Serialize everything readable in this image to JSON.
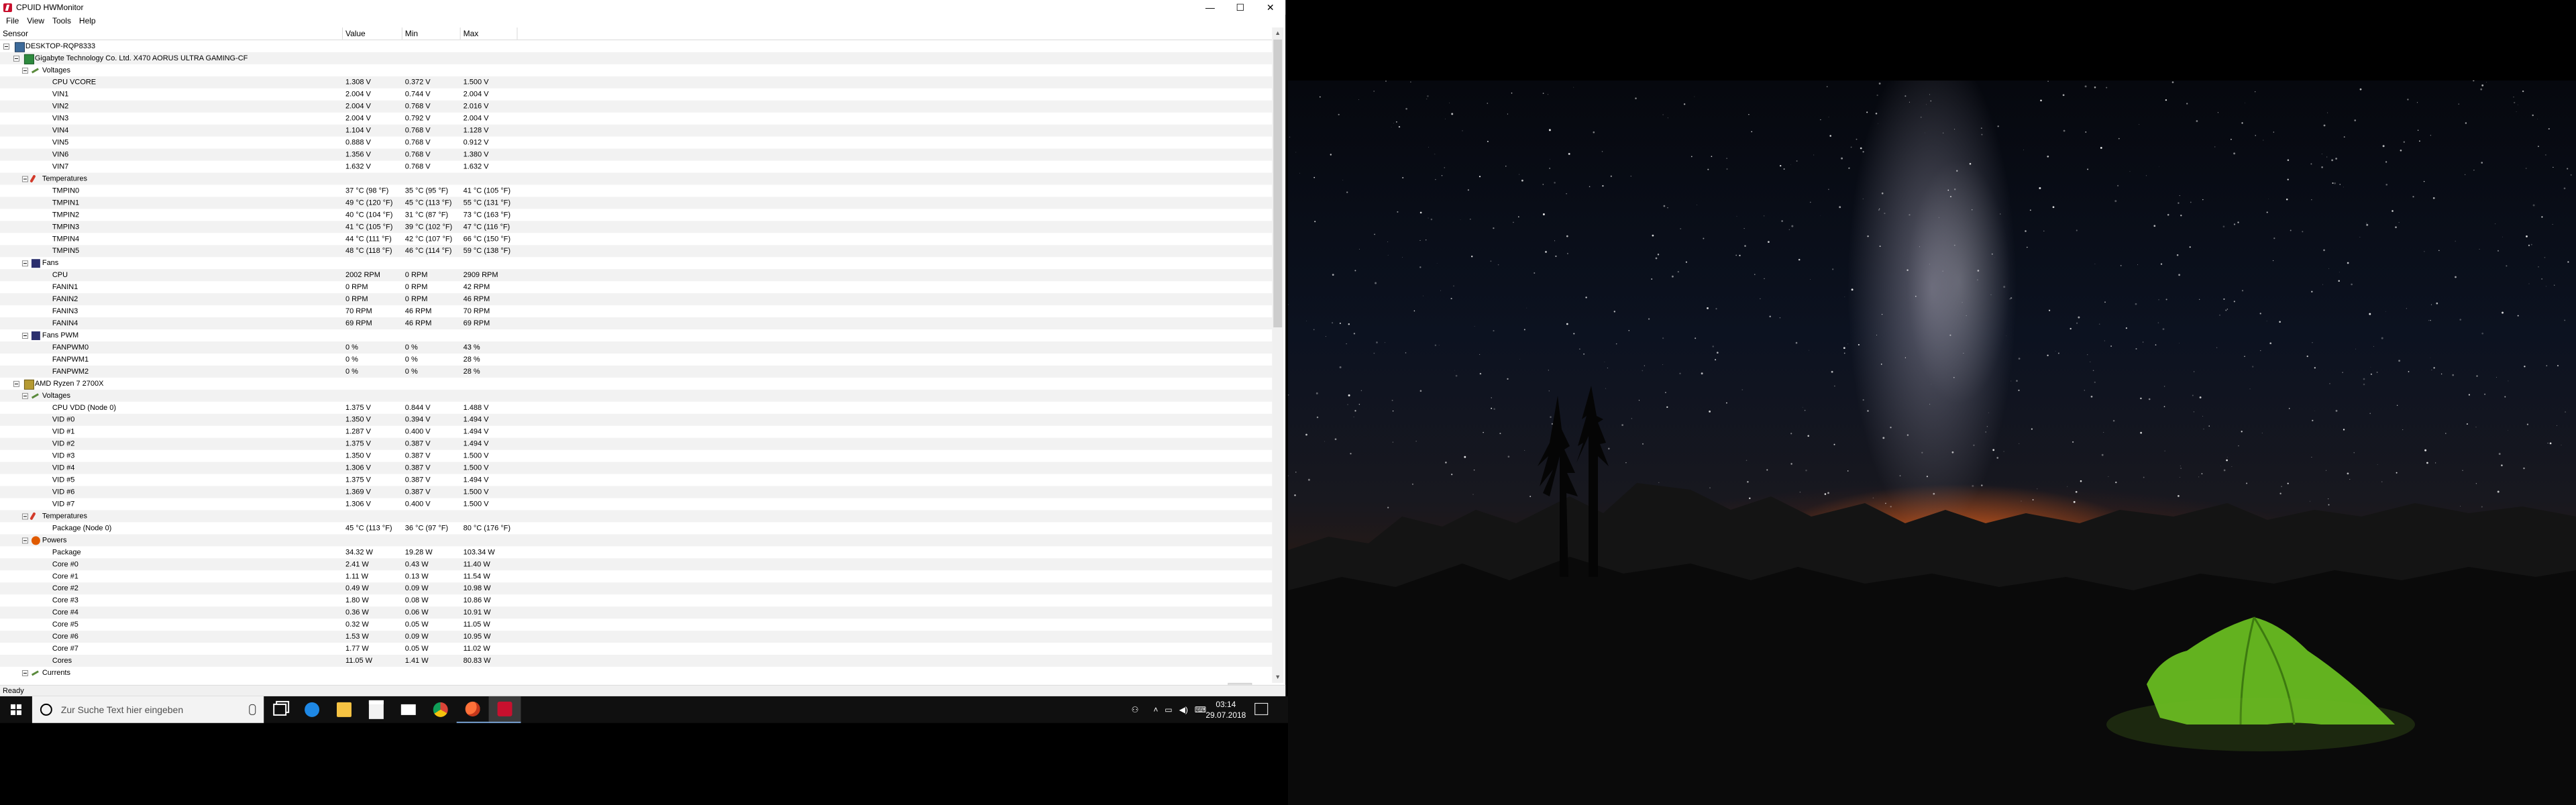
{
  "window": {
    "title": "CPUID HWMonitor",
    "controls": {
      "minimize": "—",
      "maximize": "☐",
      "close": "✕"
    },
    "menu": [
      "File",
      "View",
      "Tools",
      "Help"
    ],
    "columns": {
      "sensor": "Sensor",
      "value": "Value",
      "min": "Min",
      "max": "Max"
    },
    "status": "Ready"
  },
  "tree": [
    {
      "level": 0,
      "type": "node",
      "toggle": true,
      "glyph": "pc",
      "label": "DESKTOP-RQP8333"
    },
    {
      "level": 1,
      "type": "node",
      "toggle": true,
      "glyph": "mb",
      "label": "Gigabyte Technology Co. Ltd. X470 AORUS ULTRA GAMING-CF"
    },
    {
      "level": 2,
      "type": "node",
      "toggle": true,
      "glyph": "volt",
      "label": "Voltages"
    },
    {
      "level": 3,
      "type": "leaf",
      "label": "CPU VCORE",
      "value": "1.308 V",
      "min": "0.372 V",
      "max": "1.500 V"
    },
    {
      "level": 3,
      "type": "leaf",
      "label": "VIN1",
      "value": "2.004 V",
      "min": "0.744 V",
      "max": "2.004 V"
    },
    {
      "level": 3,
      "type": "leaf",
      "label": "VIN2",
      "value": "2.004 V",
      "min": "0.768 V",
      "max": "2.016 V"
    },
    {
      "level": 3,
      "type": "leaf",
      "label": "VIN3",
      "value": "2.004 V",
      "min": "0.792 V",
      "max": "2.004 V"
    },
    {
      "level": 3,
      "type": "leaf",
      "label": "VIN4",
      "value": "1.104 V",
      "min": "0.768 V",
      "max": "1.128 V"
    },
    {
      "level": 3,
      "type": "leaf",
      "label": "VIN5",
      "value": "0.888 V",
      "min": "0.768 V",
      "max": "0.912 V"
    },
    {
      "level": 3,
      "type": "leaf",
      "label": "VIN6",
      "value": "1.356 V",
      "min": "0.768 V",
      "max": "1.380 V"
    },
    {
      "level": 3,
      "type": "leaf",
      "label": "VIN7",
      "value": "1.632 V",
      "min": "0.768 V",
      "max": "1.632 V"
    },
    {
      "level": 2,
      "type": "node",
      "toggle": true,
      "glyph": "temp",
      "label": "Temperatures"
    },
    {
      "level": 3,
      "type": "leaf",
      "label": "TMPIN0",
      "value": "37 °C  (98 °F)",
      "min": "35 °C  (95 °F)",
      "max": "41 °C  (105 °F)"
    },
    {
      "level": 3,
      "type": "leaf",
      "label": "TMPIN1",
      "value": "49 °C  (120 °F)",
      "min": "45 °C  (113 °F)",
      "max": "55 °C  (131 °F)"
    },
    {
      "level": 3,
      "type": "leaf",
      "label": "TMPIN2",
      "value": "40 °C  (104 °F)",
      "min": "31 °C  (87 °F)",
      "max": "73 °C  (163 °F)"
    },
    {
      "level": 3,
      "type": "leaf",
      "label": "TMPIN3",
      "value": "41 °C  (105 °F)",
      "min": "39 °C  (102 °F)",
      "max": "47 °C  (116 °F)"
    },
    {
      "level": 3,
      "type": "leaf",
      "label": "TMPIN4",
      "value": "44 °C  (111 °F)",
      "min": "42 °C  (107 °F)",
      "max": "66 °C  (150 °F)"
    },
    {
      "level": 3,
      "type": "leaf",
      "label": "TMPIN5",
      "value": "48 °C  (118 °F)",
      "min": "46 °C  (114 °F)",
      "max": "59 °C  (138 °F)"
    },
    {
      "level": 2,
      "type": "node",
      "toggle": true,
      "glyph": "fan",
      "label": "Fans"
    },
    {
      "level": 3,
      "type": "leaf",
      "label": "CPU",
      "value": "2002 RPM",
      "min": "0 RPM",
      "max": "2909 RPM"
    },
    {
      "level": 3,
      "type": "leaf",
      "label": "FANIN1",
      "value": "0 RPM",
      "min": "0 RPM",
      "max": "42 RPM"
    },
    {
      "level": 3,
      "type": "leaf",
      "label": "FANIN2",
      "value": "0 RPM",
      "min": "0 RPM",
      "max": "46 RPM"
    },
    {
      "level": 3,
      "type": "leaf",
      "label": "FANIN3",
      "value": "70 RPM",
      "min": "46 RPM",
      "max": "70 RPM"
    },
    {
      "level": 3,
      "type": "leaf",
      "label": "FANIN4",
      "value": "69 RPM",
      "min": "46 RPM",
      "max": "69 RPM"
    },
    {
      "level": 2,
      "type": "node",
      "toggle": true,
      "glyph": "fan",
      "label": "Fans PWM"
    },
    {
      "level": 3,
      "type": "leaf",
      "label": "FANPWM0",
      "value": "0 %",
      "min": "0 %",
      "max": "43 %"
    },
    {
      "level": 3,
      "type": "leaf",
      "label": "FANPWM1",
      "value": "0 %",
      "min": "0 %",
      "max": "28 %"
    },
    {
      "level": 3,
      "type": "leaf",
      "label": "FANPWM2",
      "value": "0 %",
      "min": "0 %",
      "max": "28 %"
    },
    {
      "level": 1,
      "type": "node",
      "toggle": true,
      "glyph": "cpu",
      "label": "AMD Ryzen 7 2700X"
    },
    {
      "level": 2,
      "type": "node",
      "toggle": true,
      "glyph": "volt",
      "label": "Voltages"
    },
    {
      "level": 3,
      "type": "leaf",
      "label": "CPU VDD (Node 0)",
      "value": "1.375 V",
      "min": "0.844 V",
      "max": "1.488 V"
    },
    {
      "level": 3,
      "type": "leaf",
      "label": "VID #0",
      "value": "1.350 V",
      "min": "0.394 V",
      "max": "1.494 V"
    },
    {
      "level": 3,
      "type": "leaf",
      "label": "VID #1",
      "value": "1.287 V",
      "min": "0.400 V",
      "max": "1.494 V"
    },
    {
      "level": 3,
      "type": "leaf",
      "label": "VID #2",
      "value": "1.375 V",
      "min": "0.387 V",
      "max": "1.494 V"
    },
    {
      "level": 3,
      "type": "leaf",
      "label": "VID #3",
      "value": "1.350 V",
      "min": "0.387 V",
      "max": "1.500 V"
    },
    {
      "level": 3,
      "type": "leaf",
      "label": "VID #4",
      "value": "1.306 V",
      "min": "0.387 V",
      "max": "1.500 V"
    },
    {
      "level": 3,
      "type": "leaf",
      "label": "VID #5",
      "value": "1.375 V",
      "min": "0.387 V",
      "max": "1.494 V"
    },
    {
      "level": 3,
      "type": "leaf",
      "label": "VID #6",
      "value": "1.369 V",
      "min": "0.387 V",
      "max": "1.500 V"
    },
    {
      "level": 3,
      "type": "leaf",
      "label": "VID #7",
      "value": "1.306 V",
      "min": "0.400 V",
      "max": "1.500 V"
    },
    {
      "level": 2,
      "type": "node",
      "toggle": true,
      "glyph": "temp",
      "label": "Temperatures"
    },
    {
      "level": 3,
      "type": "leaf",
      "label": "Package (Node 0)",
      "value": "45 °C  (113 °F)",
      "min": "36 °C  (97 °F)",
      "max": "80 °C  (176 °F)"
    },
    {
      "level": 2,
      "type": "node",
      "toggle": true,
      "glyph": "pwr",
      "label": "Powers"
    },
    {
      "level": 3,
      "type": "leaf",
      "label": "Package",
      "value": "34.32 W",
      "min": "19.28 W",
      "max": "103.34 W"
    },
    {
      "level": 3,
      "type": "leaf",
      "label": "Core #0",
      "value": "2.41 W",
      "min": "0.43 W",
      "max": "11.40 W"
    },
    {
      "level": 3,
      "type": "leaf",
      "label": "Core #1",
      "value": "1.11 W",
      "min": "0.13 W",
      "max": "11.54 W"
    },
    {
      "level": 3,
      "type": "leaf",
      "label": "Core #2",
      "value": "0.49 W",
      "min": "0.09 W",
      "max": "10.98 W"
    },
    {
      "level": 3,
      "type": "leaf",
      "label": "Core #3",
      "value": "1.80 W",
      "min": "0.08 W",
      "max": "10.86 W"
    },
    {
      "level": 3,
      "type": "leaf",
      "label": "Core #4",
      "value": "0.36 W",
      "min": "0.06 W",
      "max": "10.91 W"
    },
    {
      "level": 3,
      "type": "leaf",
      "label": "Core #5",
      "value": "0.32 W",
      "min": "0.05 W",
      "max": "11.05 W"
    },
    {
      "level": 3,
      "type": "leaf",
      "label": "Core #6",
      "value": "1.53 W",
      "min": "0.09 W",
      "max": "10.95 W"
    },
    {
      "level": 3,
      "type": "leaf",
      "label": "Core #7",
      "value": "1.77 W",
      "min": "0.05 W",
      "max": "11.02 W"
    },
    {
      "level": 3,
      "type": "leaf",
      "label": "Cores",
      "value": "11.05 W",
      "min": "1.41 W",
      "max": "80.83 W"
    },
    {
      "level": 2,
      "type": "node",
      "toggle": true,
      "glyph": "volt",
      "label": "Currents"
    }
  ],
  "taskbar": {
    "search_placeholder": "Zur Suche Text hier eingeben",
    "apps": [
      "task-view-icon",
      "edge-icon",
      "file-explorer-icon",
      "store-icon",
      "mail-icon",
      "chrome-icon",
      "firefox-icon",
      "hwmonitor-icon"
    ],
    "clock_time": "03:14",
    "clock_date": "29.07.2018"
  },
  "colors": {
    "accent": "#7aa6d9",
    "taskbar": "#101010",
    "hw_red": "#c8102e"
  }
}
